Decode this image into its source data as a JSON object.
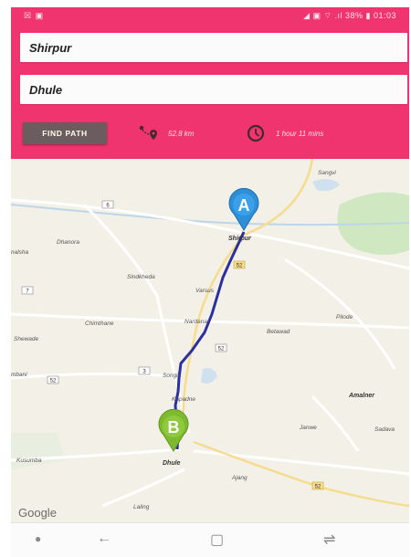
{
  "status_bar": {
    "left_icons": "☒ ▣",
    "right_text": "◢ ▣ ⌔ .ıl 38% ▮ 01:03"
  },
  "search": {
    "origin_value": "Shirpur",
    "destination_value": "Dhule"
  },
  "controls": {
    "find_path_label": "FIND PATH",
    "distance_text": "52.8 km",
    "duration_text": "1 hour 11 mins",
    "distance_icon": "route-pin-icon",
    "duration_icon": "clock-icon"
  },
  "map": {
    "marker_a": "A",
    "marker_b": "B",
    "places": {
      "sangvi": "Sangvi",
      "shirpur": "Shirpur",
      "dhanora": "Dhanora",
      "sindkheda": "Sindkheda",
      "varsus": "Varsus",
      "chimthane": "Chimthane",
      "nardana": "Nardana",
      "betawad": "Betawad",
      "pilode": "Pilode",
      "shewade": "Shewade",
      "songir": "Songir",
      "kapadne": "Kapadne",
      "amalner": "Amalner",
      "janwe": "Janwe",
      "sadava": "Sadava",
      "kusumba": "Kusumba",
      "dhule": "Dhule",
      "ajang": "Ajang",
      "laling": "Laling",
      "nalsha": "nalsha",
      "ambani": "mbani"
    },
    "shields": [
      "6",
      "52",
      "7",
      "52",
      "3",
      "52",
      "52"
    ],
    "attribution": "Google"
  },
  "colors": {
    "header": "#f0346f",
    "route": "#2b2fa0",
    "marker_a": "#2d8fd8",
    "marker_b": "#7dba2e"
  },
  "nav": {
    "recent_icon": "recent-apps-icon",
    "back_icon": "back-icon",
    "home_icon": "home-icon",
    "switch_icon": "switch-icon"
  }
}
